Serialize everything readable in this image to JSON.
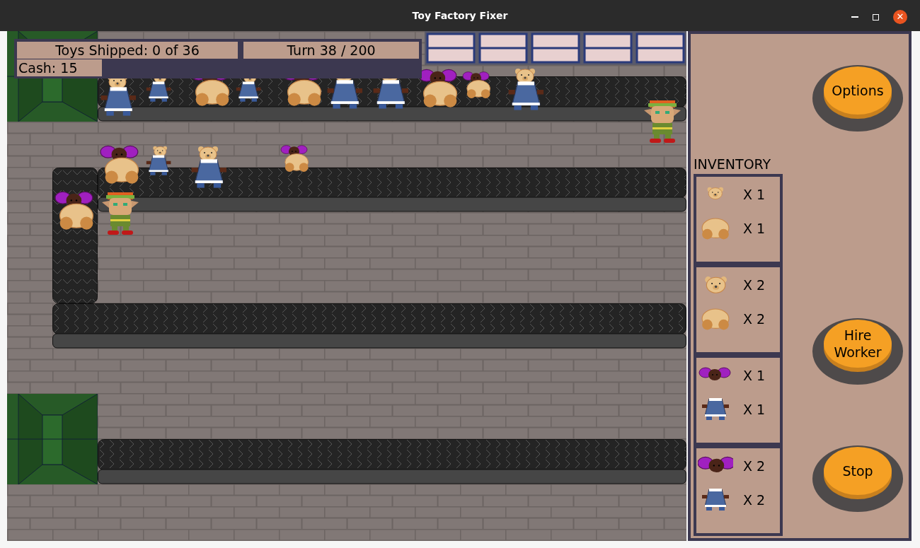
{
  "window": {
    "title": "Toy Factory Fixer",
    "close": "✕"
  },
  "hud": {
    "shipped": "Toys Shipped: 0 of 36",
    "turn": "Turn 38 / 200",
    "cash": "Cash: 15"
  },
  "belt_toys": [
    {
      "kind": "bear-doll"
    },
    {
      "kind": "bear-doll-small"
    },
    {
      "kind": "pigtail-doll"
    },
    {
      "kind": "bear-doll-small"
    },
    {
      "kind": "pigtail-doll"
    },
    {
      "kind": "bear-doll"
    },
    {
      "kind": "bear-doll"
    },
    {
      "kind": "pigtail-doll"
    },
    {
      "kind": "pigtail-doll-small"
    },
    {
      "kind": "bear-doll"
    },
    {
      "kind": "pigtail-doll"
    },
    {
      "kind": "bear-doll-small"
    },
    {
      "kind": "bear-doll"
    },
    {
      "kind": "pigtail-doll-small"
    },
    {
      "kind": "pigtail-doll"
    }
  ],
  "inventory": {
    "title": "INVENTORY",
    "slots": [
      {
        "items": [
          {
            "kind": "bear-head-small",
            "count": "X 1"
          },
          {
            "kind": "bear-body",
            "count": "X 1"
          }
        ]
      },
      {
        "items": [
          {
            "kind": "bear-head",
            "count": "X 2"
          },
          {
            "kind": "bear-body",
            "count": "X 2"
          }
        ]
      },
      {
        "items": [
          {
            "kind": "doll-head-small",
            "count": "X 1"
          },
          {
            "kind": "dress",
            "count": "X 1"
          }
        ]
      },
      {
        "items": [
          {
            "kind": "doll-head",
            "count": "X 2"
          },
          {
            "kind": "dress",
            "count": "X 2"
          }
        ]
      }
    ]
  },
  "buttons": [
    "Options",
    "Hire Worker",
    "Stop"
  ]
}
